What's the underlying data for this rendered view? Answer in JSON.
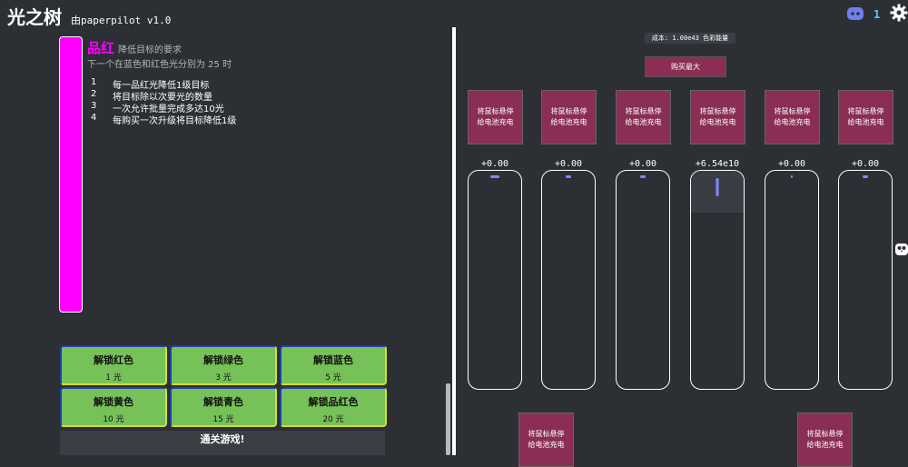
{
  "header": {
    "title": "光之树",
    "author": "由paperpilot v1.0",
    "online_count": "1"
  },
  "left": {
    "color_name": "品红",
    "goal_text": "降低目标的要求",
    "subline": "下一个在蓝色和红色光分别为 25 时",
    "perks": [
      {
        "num": "1",
        "text": "每一品红光降低1级目标"
      },
      {
        "num": "2",
        "text": "将目标除以次要光的数量"
      },
      {
        "num": "3",
        "text": "一次允许批量完成多达10光"
      },
      {
        "num": "4",
        "text": "每购买一次升级将目标降低1级"
      }
    ],
    "unlocks": [
      {
        "label": "解锁红色",
        "cost": "1 光"
      },
      {
        "label": "解锁绿色",
        "cost": "3 光"
      },
      {
        "label": "解锁蓝色",
        "cost": "5 光"
      },
      {
        "label": "解锁黄色",
        "cost": "10 光"
      },
      {
        "label": "解锁青色",
        "cost": "15 光"
      },
      {
        "label": "解锁品红色",
        "cost": "20 光"
      }
    ],
    "win_label": "通关游戏!"
  },
  "right": {
    "cost_label": "成本: 1.00e43 色彩能量",
    "buy_max_label": "购买最大",
    "hover_label_line1": "将鼠标悬停",
    "hover_label_line2": "给电池充电",
    "batteries": [
      {
        "amount": "+0.00",
        "fill": 0.0
      },
      {
        "amount": "+0.00",
        "fill": 0.0
      },
      {
        "amount": "+0.00",
        "fill": 0.0
      },
      {
        "amount": "+6.54e10",
        "fill": 0.19
      },
      {
        "amount": "+0.00",
        "fill": 0.0
      },
      {
        "amount": "+0.00",
        "fill": 0.0
      }
    ]
  },
  "colors": {
    "magenta": "#ff00ff",
    "button_maroon": "#8a2e55",
    "unlock_green": "#77c159",
    "link_blue": "#4fd1ff"
  },
  "icons": [
    "discord-icon",
    "gear-icon",
    "owl-icon"
  ]
}
